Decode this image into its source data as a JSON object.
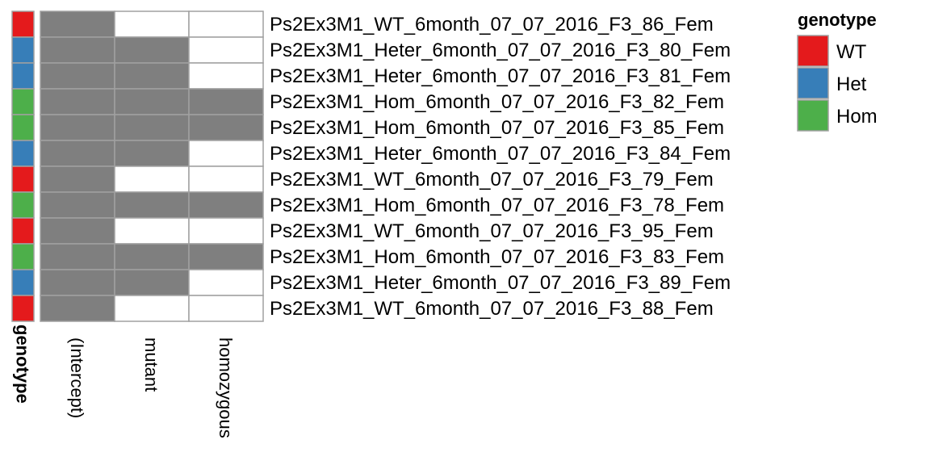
{
  "chart_data": {
    "type": "heatmap",
    "columns": [
      "(Intercept)",
      "mutant",
      "homozygous"
    ],
    "rows": [
      "Ps2Ex3M1_WT_6month_07_07_2016_F3_86_Fem",
      "Ps2Ex3M1_Heter_6month_07_07_2016_F3_80_Fem",
      "Ps2Ex3M1_Heter_6month_07_07_2016_F3_81_Fem",
      "Ps2Ex3M1_Hom_6month_07_07_2016_F3_82_Fem",
      "Ps2Ex3M1_Hom_6month_07_07_2016_F3_85_Fem",
      "Ps2Ex3M1_Heter_6month_07_07_2016_F3_84_Fem",
      "Ps2Ex3M1_WT_6month_07_07_2016_F3_79_Fem",
      "Ps2Ex3M1_Hom_6month_07_07_2016_F3_78_Fem",
      "Ps2Ex3M1_WT_6month_07_07_2016_F3_95_Fem",
      "Ps2Ex3M1_Hom_6month_07_07_2016_F3_83_Fem",
      "Ps2Ex3M1_Heter_6month_07_07_2016_F3_89_Fem",
      "Ps2Ex3M1_WT_6month_07_07_2016_F3_88_Fem"
    ],
    "values": [
      [
        1,
        0,
        0
      ],
      [
        1,
        1,
        0
      ],
      [
        1,
        1,
        0
      ],
      [
        1,
        1,
        1
      ],
      [
        1,
        1,
        1
      ],
      [
        1,
        1,
        0
      ],
      [
        1,
        0,
        0
      ],
      [
        1,
        1,
        1
      ],
      [
        1,
        0,
        0
      ],
      [
        1,
        1,
        1
      ],
      [
        1,
        1,
        0
      ],
      [
        1,
        0,
        0
      ]
    ],
    "row_annotation": {
      "name": "genotype",
      "values": [
        "WT",
        "Het",
        "Het",
        "Hom",
        "Hom",
        "Het",
        "WT",
        "Hom",
        "WT",
        "Hom",
        "Het",
        "WT"
      ]
    },
    "legend": {
      "title": "genotype",
      "position": "right",
      "items": [
        {
          "label": "WT",
          "color": "#E41A1C"
        },
        {
          "label": "Het",
          "color": "#377EB8"
        },
        {
          "label": "Hom",
          "color": "#4DAF4A"
        }
      ]
    },
    "colors": {
      "one": "#7F7F7F",
      "zero": "#FFFFFF",
      "cell_border": "#A0A0A0"
    }
  }
}
